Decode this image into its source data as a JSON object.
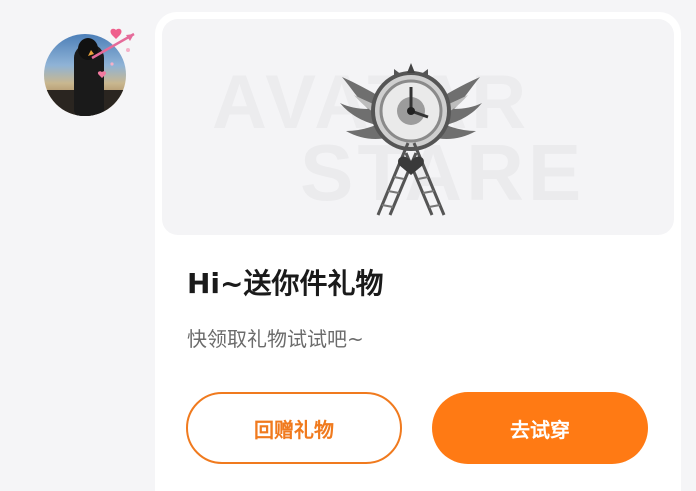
{
  "user": {
    "avatar_icon": "profile-photo"
  },
  "banner": {
    "watermark_line1": "AVATAR",
    "watermark_line2": "STARE",
    "emblem_icon": "winged-clock-emblem-icon"
  },
  "gift": {
    "title": "Hi~送你件礼物",
    "subtitle": "快领取礼物试试吧~"
  },
  "actions": {
    "return_gift_label": "回赠礼物",
    "try_on_label": "去试穿"
  },
  "colors": {
    "accent": "#ff7a14",
    "outline": "#f07a1e",
    "background": "#f5f5f7",
    "card": "#ffffff"
  }
}
